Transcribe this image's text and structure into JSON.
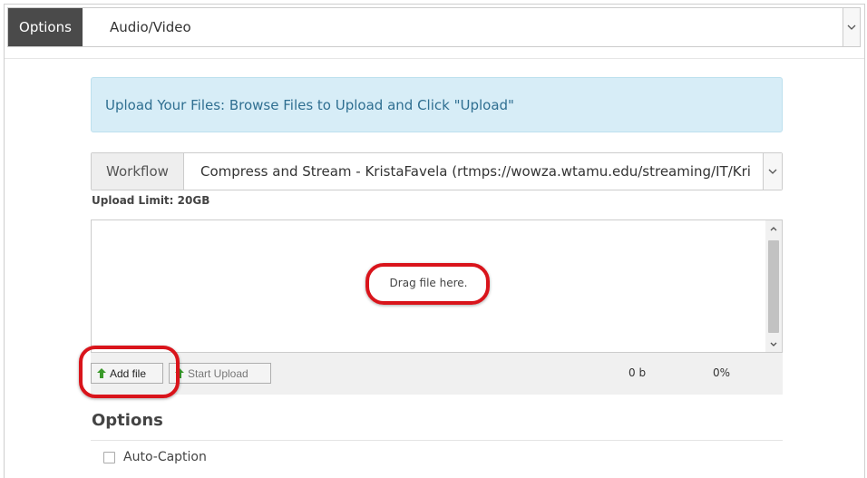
{
  "topbar": {
    "options_label": "Options",
    "media_type": "Audio/Video"
  },
  "banner": {
    "text": "Upload Your Files: Browse Files to Upload and Click \"Upload\""
  },
  "workflow": {
    "label": "Workflow",
    "value": "Compress and Stream - KristaFavela (rtmps://wowza.wtamu.edu/streaming/IT/Kri"
  },
  "upload_limit": "Upload Limit: 20GB",
  "dropzone": {
    "text": "Drag file here."
  },
  "uploader": {
    "add_file_label": "Add file",
    "start_upload_label": "Start Upload",
    "size": "0 b",
    "percent": "0%"
  },
  "options": {
    "heading": "Options",
    "auto_caption_label": "Auto-Caption"
  },
  "colors": {
    "highlight": "#d9141b",
    "banner_bg": "#d7edf7",
    "banner_text": "#2f6f91",
    "add_icon": "#3a9a2a"
  }
}
